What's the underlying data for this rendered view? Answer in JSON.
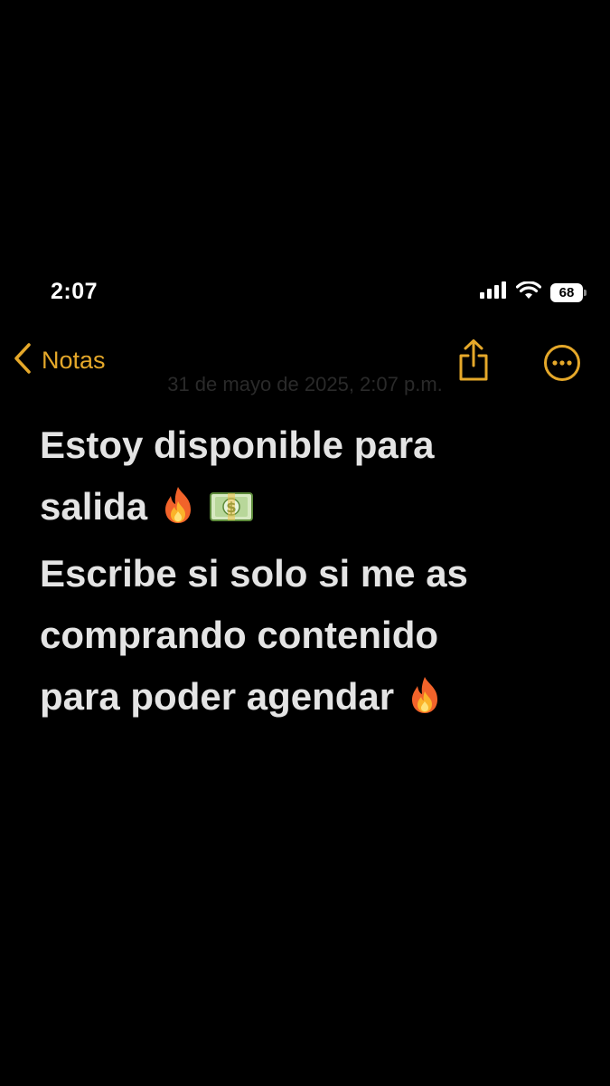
{
  "status_bar": {
    "time": "2:07",
    "battery_level": "68",
    "signal_icon": "cellular-signal-icon",
    "wifi_icon": "wifi-icon"
  },
  "nav": {
    "back_label": "Notas",
    "back_icon": "chevron-left-icon",
    "share_icon": "share-icon",
    "more_icon": "ellipsis-circle-icon"
  },
  "note": {
    "date": "31 de mayo de 2025, 2:07 p.m.",
    "lines": [
      "Estoy disponible para",
      "salida",
      "Escribe si solo si me as",
      "comprando contenido",
      "para poder agendar"
    ],
    "emojis": [
      "fire-emoji",
      "money-emoji",
      "fire-emoji"
    ]
  },
  "colors": {
    "background": "#000000",
    "accent": "#e5a82a",
    "text": "#e4e4e4"
  }
}
